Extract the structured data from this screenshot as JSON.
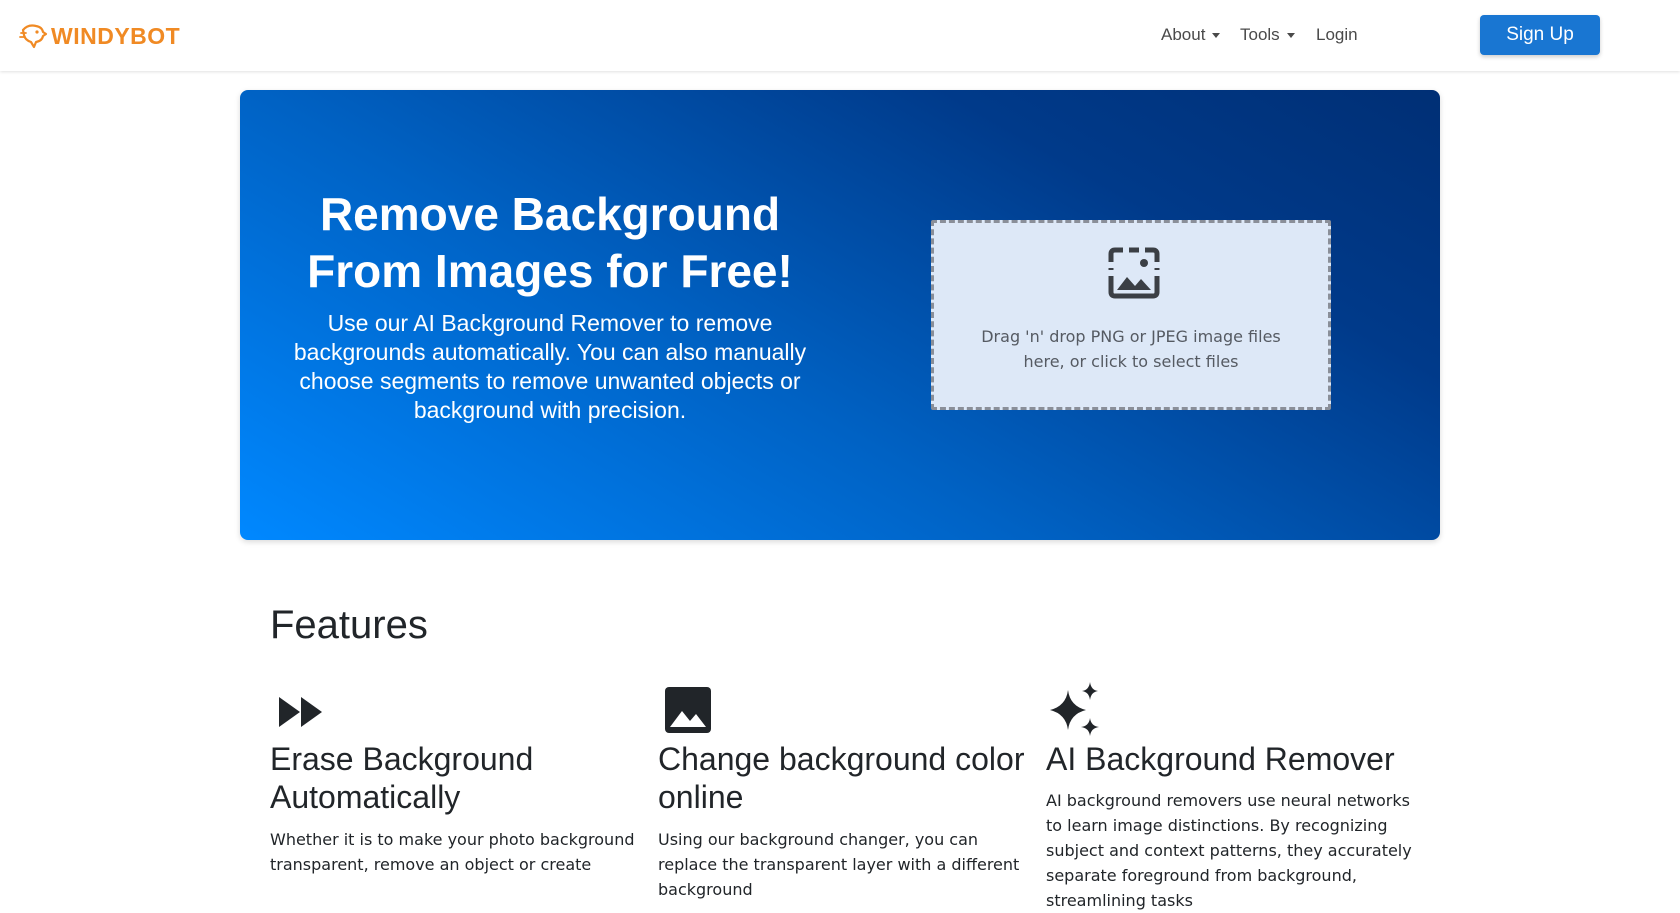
{
  "navbar": {
    "brand": "WINDYBOT",
    "about_label": "About",
    "tools_label": "Tools",
    "login_label": "Login",
    "signup_label": "Sign Up",
    "brand_color": "#f08a24",
    "accent_color": "#1976d2"
  },
  "hero": {
    "title": "Remove Background From Images for Free!",
    "subtitle": "Use our AI Background Remover to remove backgrounds automatically. You can also manually choose segments to remove unwanted objects or background with precision.",
    "dropzone_text": "Drag 'n' drop PNG or JPEG image files here, or click to select files",
    "dropzone_icon": "image-upload-icon"
  },
  "features": {
    "title": "Features",
    "items": [
      {
        "icon": "fast-forward-icon",
        "title": "Erase Background Automatically",
        "text": "Whether it is to make your photo background transparent, remove an object or create"
      },
      {
        "icon": "image-icon",
        "title": "Change background color online",
        "text": "Using our background changer, you can replace the transparent layer with a different background"
      },
      {
        "icon": "sparkles-icon",
        "title": "AI Background Remover",
        "text": "AI background removers use neural networks to learn image distinctions. By recognizing subject and context patterns, they accurately separate foreground from background, streamlining tasks"
      }
    ]
  }
}
